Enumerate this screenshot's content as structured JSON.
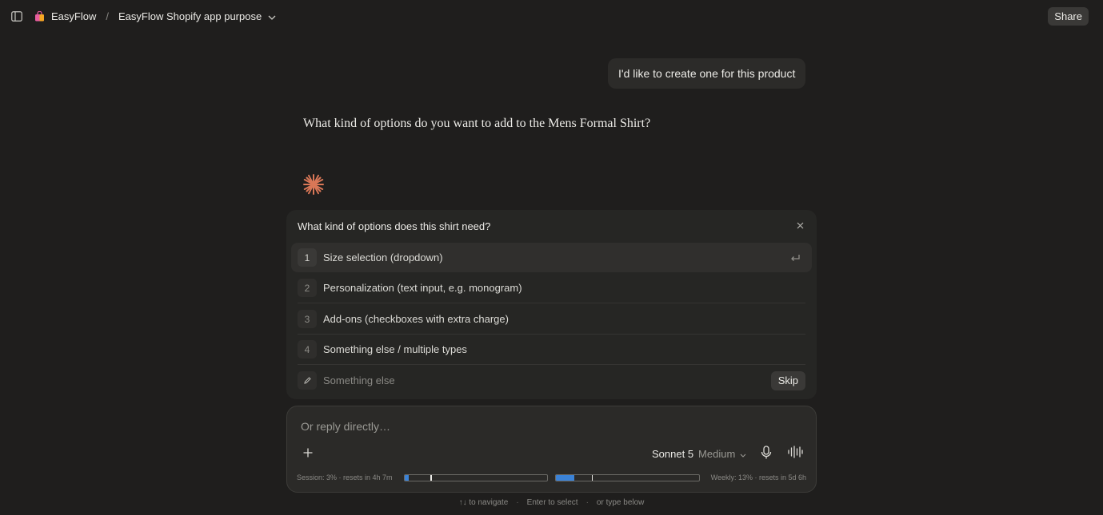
{
  "header": {
    "project_name": "EasyFlow",
    "separator": "/",
    "chat_title": "EasyFlow Shopify app purpose",
    "share_label": "Share"
  },
  "conversation": {
    "user_message": "I'd like to create one for this product",
    "assistant_message": "What kind of options do you want to add to the Mens Formal Shirt?"
  },
  "question_card": {
    "title": "What kind of options does this shirt need?",
    "options": [
      {
        "num": "1",
        "label": "Size selection (dropdown)"
      },
      {
        "num": "2",
        "label": "Personalization (text input, e.g. monogram)"
      },
      {
        "num": "3",
        "label": "Add-ons (checkboxes with extra charge)"
      },
      {
        "num": "4",
        "label": "Something else / multiple types"
      }
    ],
    "other_placeholder": "Something else",
    "skip_label": "Skip"
  },
  "composer": {
    "placeholder": "Or reply directly…",
    "model_name": "Sonnet 5",
    "model_effort": "Medium",
    "session_usage": {
      "label": "Session: 3% · resets in 4h 7m",
      "percent": 3,
      "marker_percent": 18
    },
    "weekly_usage": {
      "label": "Weekly: 13% · resets in 5d 6h",
      "percent": 13,
      "marker_percent": 25
    }
  },
  "hints": {
    "navigate": "↑↓ to navigate",
    "select": "Enter to select",
    "type": "or type below",
    "dot": "·"
  },
  "colors": {
    "background": "#1f1e1d",
    "accent_spark": "#d97757",
    "usage_bar": "#3b82d6"
  }
}
